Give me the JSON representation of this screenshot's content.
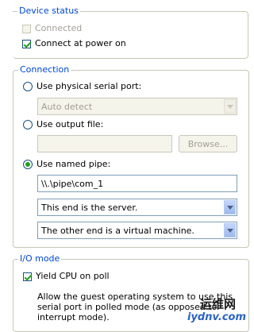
{
  "device_status": {
    "legend": "Device status",
    "connected_label": "Connected",
    "connected_checked": false,
    "connect_power_label": "Connect at power on",
    "connect_power_checked": true
  },
  "connection": {
    "legend": "Connection",
    "physical_serial_label": "Use physical serial port:",
    "physical_serial_dropdown": "Auto detect",
    "output_file_label": "Use output file:",
    "output_file_value": "",
    "browse_label": "Browse...",
    "named_pipe_label": "Use named pipe:",
    "selected_option": "named_pipe",
    "pipe_name_value": "\\\\.\\pipe\\com_1",
    "this_end_value": "This end is the server.",
    "other_end_value": "The other end is a virtual machine."
  },
  "io_mode": {
    "legend": "I/O mode",
    "yield_cpu_label": "Yield CPU on poll",
    "yield_cpu_checked": true,
    "description": "Allow the guest operating system to use this serial port in polled mode (as opposed to interrupt mode)."
  },
  "watermark": {
    "text1": "运维网",
    "text2": "iydnv.com"
  },
  "colors": {
    "legend_text": "#0046d5",
    "check_green": "#21a121",
    "group_border": "#c9c6b7",
    "disabled_text": "#a19f96"
  }
}
